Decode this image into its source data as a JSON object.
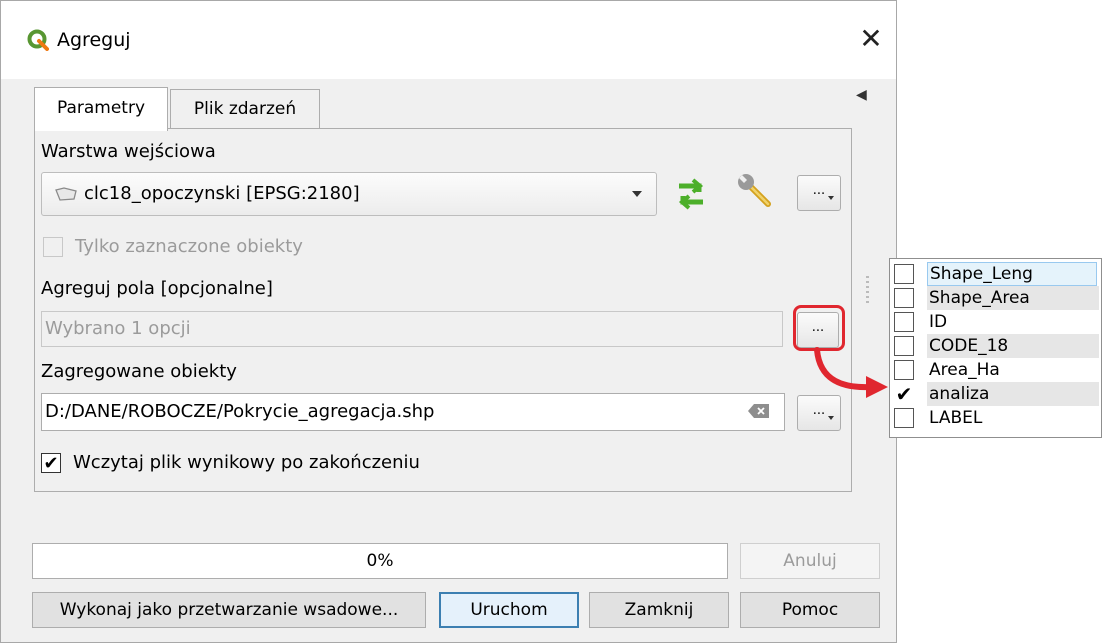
{
  "window": {
    "title": "Agreguj",
    "close_label": "✕"
  },
  "tabs": [
    {
      "label": "Parametry"
    },
    {
      "label": "Plik zdarzeń"
    }
  ],
  "params": {
    "input_layer_label": "Warstwa wejściowa",
    "input_layer_value": "clc18_opoczynski [EPSG:2180]",
    "selected_only_label": "Tylko zaznaczone obiekty",
    "aggregate_fields_label": "Agreguj pola [opcjonalne]",
    "aggregate_fields_value": "Wybrano 1 opcji",
    "output_label": "Zagregowane obiekty",
    "output_value": "D:/DANE/ROBOCZE/Pokrycie_agregacja.shp",
    "load_result_label": "Wczytaj plik wynikowy po zakończeniu",
    "load_result_checked": true,
    "dots": "..."
  },
  "footer": {
    "progress_text": "0%",
    "progress_value": 0,
    "cancel": "Anuluj",
    "batch": "Wykonaj jako przetwarzanie wsadowe...",
    "run": "Uruchom",
    "close": "Zamknij",
    "help": "Pomoc"
  },
  "field_popup": {
    "items": [
      {
        "label": "Shape_Leng",
        "checked": false
      },
      {
        "label": "Shape_Area",
        "checked": false
      },
      {
        "label": "ID",
        "checked": false
      },
      {
        "label": "CODE_18",
        "checked": false
      },
      {
        "label": "Area_Ha",
        "checked": false
      },
      {
        "label": "analiza",
        "checked": true
      },
      {
        "label": "LABEL",
        "checked": false
      }
    ]
  },
  "colors": {
    "highlight": "#e0272f",
    "qgis_green": "#589632",
    "dialog_bg": "#f0f0f0"
  }
}
